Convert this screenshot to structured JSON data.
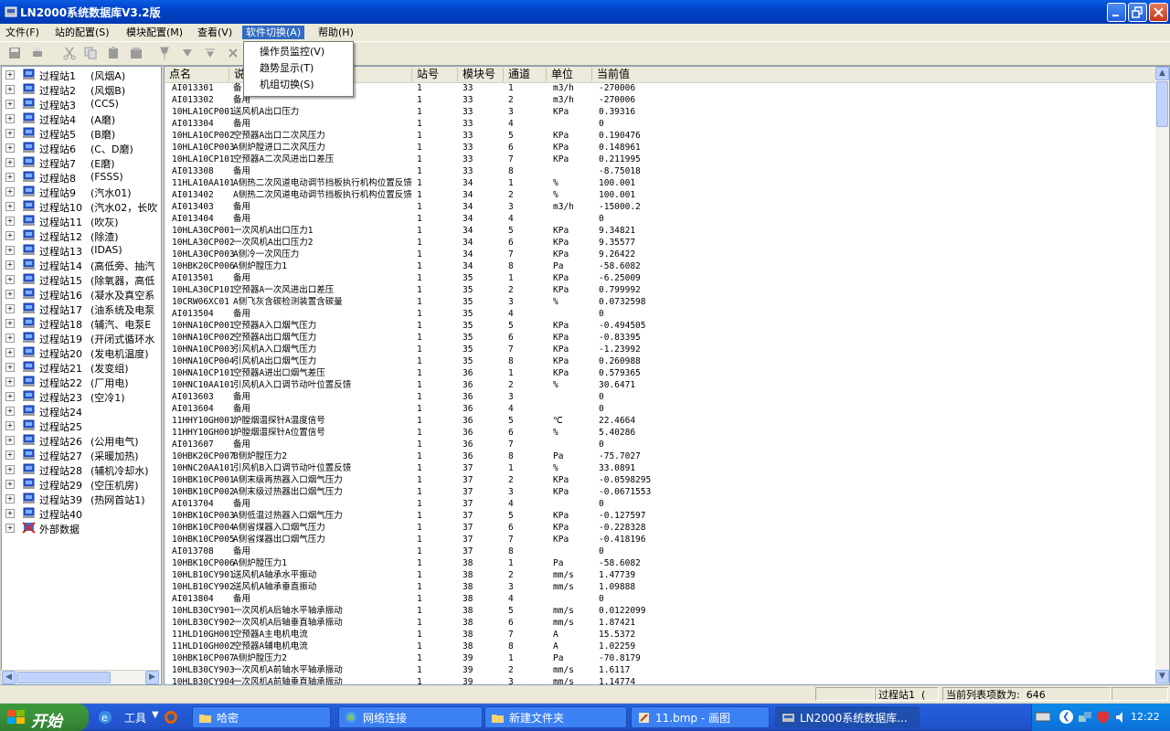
{
  "window": {
    "title": "LN2000系统数据库V3.2版"
  },
  "menu": {
    "items": [
      {
        "label": "文件(F)"
      },
      {
        "label": "站的配置(S)"
      },
      {
        "label": "模块配置(M)"
      },
      {
        "label": "查看(V)"
      },
      {
        "label": "软件切换(A)"
      },
      {
        "label": "帮助(H)"
      }
    ],
    "dropdown": [
      {
        "label": "操作员监控(V)"
      },
      {
        "label": "趋势显示(T)"
      },
      {
        "label": "机组切换(S)"
      }
    ]
  },
  "tree": {
    "nodes": [
      {
        "label": "过程站1",
        "sub": "(风烟A)"
      },
      {
        "label": "过程站2",
        "sub": "(风烟B)"
      },
      {
        "label": "过程站3",
        "sub": "(CCS)"
      },
      {
        "label": "过程站4",
        "sub": "(A磨)"
      },
      {
        "label": "过程站5",
        "sub": "(B磨)"
      },
      {
        "label": "过程站6",
        "sub": "(C、D磨)"
      },
      {
        "label": "过程站7",
        "sub": "(E磨)"
      },
      {
        "label": "过程站8",
        "sub": "(FSSS)"
      },
      {
        "label": "过程站9",
        "sub": "(汽水01)"
      },
      {
        "label": "过程站10",
        "sub": "(汽水02，长吹"
      },
      {
        "label": "过程站11",
        "sub": "(吹灰)"
      },
      {
        "label": "过程站12",
        "sub": "(除渣)"
      },
      {
        "label": "过程站13",
        "sub": "(IDAS)"
      },
      {
        "label": "过程站14",
        "sub": "(高低旁、抽汽"
      },
      {
        "label": "过程站15",
        "sub": "(除氧器，高低"
      },
      {
        "label": "过程站16",
        "sub": "(凝水及真空系"
      },
      {
        "label": "过程站17",
        "sub": "(油系统及电泵"
      },
      {
        "label": "过程站18",
        "sub": "(辅汽、电泵E"
      },
      {
        "label": "过程站19",
        "sub": "(开闭式循环水"
      },
      {
        "label": "过程站20",
        "sub": "(发电机温度)"
      },
      {
        "label": "过程站21",
        "sub": "(发变组)"
      },
      {
        "label": "过程站22",
        "sub": "(厂用电)"
      },
      {
        "label": "过程站23",
        "sub": "(空冷1)"
      },
      {
        "label": "过程站24",
        "sub": ""
      },
      {
        "label": "过程站25",
        "sub": ""
      },
      {
        "label": "过程站26",
        "sub": "(公用电气)"
      },
      {
        "label": "过程站27",
        "sub": "(采暖加热)"
      },
      {
        "label": "过程站28",
        "sub": "(辅机冷却水)"
      },
      {
        "label": "过程站29",
        "sub": "(空压机房)"
      },
      {
        "label": "过程站39",
        "sub": "(热网首站1)"
      },
      {
        "label": "过程站40",
        "sub": ""
      },
      {
        "label": "外部数据",
        "sub": ""
      }
    ]
  },
  "table": {
    "columns": [
      "点名",
      "说",
      "站号",
      "模块号",
      "通道",
      "单位",
      "当前值"
    ],
    "rows": [
      [
        "AI013301",
        "备",
        "1",
        "33",
        "1",
        "m3/h",
        "-270006"
      ],
      [
        "AI013302",
        "备用",
        "1",
        "33",
        "2",
        "m3/h",
        "-270006"
      ],
      [
        "10HLA10CP001",
        "送风机A出口压力",
        "1",
        "33",
        "3",
        "KPa",
        "0.39316"
      ],
      [
        "AI013304",
        "备用",
        "1",
        "33",
        "4",
        "",
        "0"
      ],
      [
        "10HLA10CP002",
        "空预器A出口二次风压力",
        "1",
        "33",
        "5",
        "KPa",
        "0.190476"
      ],
      [
        "10HLA10CP003",
        "A侧炉膛进口二次风压力",
        "1",
        "33",
        "6",
        "KPa",
        "0.148961"
      ],
      [
        "10HLA10CP101",
        "空预器A二次风进出口差压",
        "1",
        "33",
        "7",
        "KPa",
        "0.211995"
      ],
      [
        "AI013308",
        "备用",
        "1",
        "33",
        "8",
        "",
        "-8.75018"
      ],
      [
        "11HLA10AA101",
        "A侧热二次风道电动调节挡板执行机构位置反馈",
        "1",
        "34",
        "1",
        "%",
        "100.001"
      ],
      [
        "AI013402",
        "A侧热二次风道电动调节挡板执行机构位置反馈",
        "1",
        "34",
        "2",
        "%",
        "100.001"
      ],
      [
        "AI013403",
        "备用",
        "1",
        "34",
        "3",
        "m3/h",
        "-15000.2"
      ],
      [
        "AI013404",
        "备用",
        "1",
        "34",
        "4",
        "",
        "0"
      ],
      [
        "10HLA30CP001",
        "一次风机A出口压力1",
        "1",
        "34",
        "5",
        "KPa",
        "9.34821"
      ],
      [
        "10HLA30CP002",
        "一次风机A出口压力2",
        "1",
        "34",
        "6",
        "KPa",
        "9.35577"
      ],
      [
        "10HLA30CP003",
        "A侧冷一次风压力",
        "1",
        "34",
        "7",
        "KPa",
        "9.26422"
      ],
      [
        "10HBK20CP006",
        "A侧炉膛压力1",
        "1",
        "34",
        "8",
        "Pa",
        "-58.6082"
      ],
      [
        "AI013501",
        "备用",
        "1",
        "35",
        "1",
        "KPa",
        "-6.25009"
      ],
      [
        "10HLA30CP101",
        "空预器A一次风进出口差压",
        "1",
        "35",
        "2",
        "KPa",
        "0.799992"
      ],
      [
        "10CRW06XC01",
        "A侧飞灰含碳检测装置含碳量",
        "1",
        "35",
        "3",
        "%",
        "0.0732598"
      ],
      [
        "AI013504",
        "备用",
        "1",
        "35",
        "4",
        "",
        "0"
      ],
      [
        "10HNA10CP001",
        "空预器A入口烟气压力",
        "1",
        "35",
        "5",
        "KPa",
        "-0.494505"
      ],
      [
        "10HNA10CP002",
        "空预器A出口烟气压力",
        "1",
        "35",
        "6",
        "KPa",
        "-0.83395"
      ],
      [
        "10HNA10CP003",
        "引风机A入口烟气压力",
        "1",
        "35",
        "7",
        "KPa",
        "-1.23992"
      ],
      [
        "10HNA10CP004",
        "引风机A出口烟气压力",
        "1",
        "35",
        "8",
        "KPa",
        "0.260988"
      ],
      [
        "10HNA10CP101",
        "空预器A进出口烟气差压",
        "1",
        "36",
        "1",
        "KPa",
        "0.579365"
      ],
      [
        "10HNC10AA101",
        "引风机A入口调节动叶位置反馈",
        "1",
        "36",
        "2",
        "%",
        "30.6471"
      ],
      [
        "AI013603",
        "备用",
        "1",
        "36",
        "3",
        "",
        "0"
      ],
      [
        "AI013604",
        "备用",
        "1",
        "36",
        "4",
        "",
        "0"
      ],
      [
        "11HHY10GH001",
        "炉膛烟温探针A温度信号",
        "1",
        "36",
        "5",
        "℃",
        "22.4664"
      ],
      [
        "11HHY10GH001",
        "炉膛烟温探针A位置信号",
        "1",
        "36",
        "6",
        "%",
        "5.40286"
      ],
      [
        "AI013607",
        "备用",
        "1",
        "36",
        "7",
        "",
        "0"
      ],
      [
        "10HBK20CP007",
        "B侧炉膛压力2",
        "1",
        "36",
        "8",
        "Pa",
        "-75.7027"
      ],
      [
        "10HNC20AA101",
        "引风机B入口调节动叶位置反馈",
        "1",
        "37",
        "1",
        "%",
        "33.0891"
      ],
      [
        "10HBK10CP001",
        "A侧末级再热器入口烟气压力",
        "1",
        "37",
        "2",
        "KPa",
        "-0.0598295"
      ],
      [
        "10HBK10CP002",
        "A侧末级过热器出口烟气压力",
        "1",
        "37",
        "3",
        "KPa",
        "-0.0671553"
      ],
      [
        "AI013704",
        "备用",
        "1",
        "37",
        "4",
        "",
        "0"
      ],
      [
        "10HBK10CP003",
        "A侧低温过热器入口烟气压力",
        "1",
        "37",
        "5",
        "KPa",
        "-0.127597"
      ],
      [
        "10HBK10CP004",
        "A侧省煤器入口烟气压力",
        "1",
        "37",
        "6",
        "KPa",
        "-0.228328"
      ],
      [
        "10HBK10CP005",
        "A侧省煤器出口烟气压力",
        "1",
        "37",
        "7",
        "KPa",
        "-0.418196"
      ],
      [
        "AI013708",
        "备用",
        "1",
        "37",
        "8",
        "",
        "0"
      ],
      [
        "10HBK10CP006",
        "A侧炉膛压力1",
        "1",
        "38",
        "1",
        "Pa",
        "-58.6082"
      ],
      [
        "10HLB10CY901",
        "送风机A轴承水平振动",
        "1",
        "38",
        "2",
        "mm/s",
        "1.47739"
      ],
      [
        "10HLB10CY902",
        "送风机A轴承垂直振动",
        "1",
        "38",
        "3",
        "mm/s",
        "1.09888"
      ],
      [
        "AI013804",
        "备用",
        "1",
        "38",
        "4",
        "",
        "0"
      ],
      [
        "10HLB30CY901",
        "一次风机A后轴水平轴承振动",
        "1",
        "38",
        "5",
        "mm/s",
        "0.0122099"
      ],
      [
        "10HLB30CY902",
        "一次风机A后轴垂直轴承振动",
        "1",
        "38",
        "6",
        "mm/s",
        "1.87421"
      ],
      [
        "11HLD10GH001",
        "空预器A主电机电流",
        "1",
        "38",
        "7",
        "A",
        "15.5372"
      ],
      [
        "11HLD10GH002",
        "空预器A辅电机电流",
        "1",
        "38",
        "8",
        "A",
        "1.02259"
      ],
      [
        "10HBK10CP007",
        "A侧炉膛压力2",
        "1",
        "39",
        "1",
        "Pa",
        "-70.8179"
      ],
      [
        "10HLB30CY903",
        "一次风机A前轴水平轴承振动",
        "1",
        "39",
        "2",
        "mm/s",
        "1.6117"
      ],
      [
        "10HLB30CY904",
        "一次风机A前轴垂直轴承振动",
        "1",
        "39",
        "3",
        "mm/s",
        "1.14774"
      ]
    ]
  },
  "status": {
    "station": "过程站1",
    "paren": "(",
    "count_label": "当前列表项数为:",
    "count_value": "646"
  },
  "taskbar": {
    "start": "开始",
    "tools": "工具",
    "items": [
      {
        "label": "哈密"
      },
      {
        "label": "网络连接"
      },
      {
        "label": "新建文件夹"
      },
      {
        "label": "11.bmp - 画图"
      },
      {
        "label": "LN2000系统数据库..."
      }
    ],
    "clock": "12:22"
  }
}
